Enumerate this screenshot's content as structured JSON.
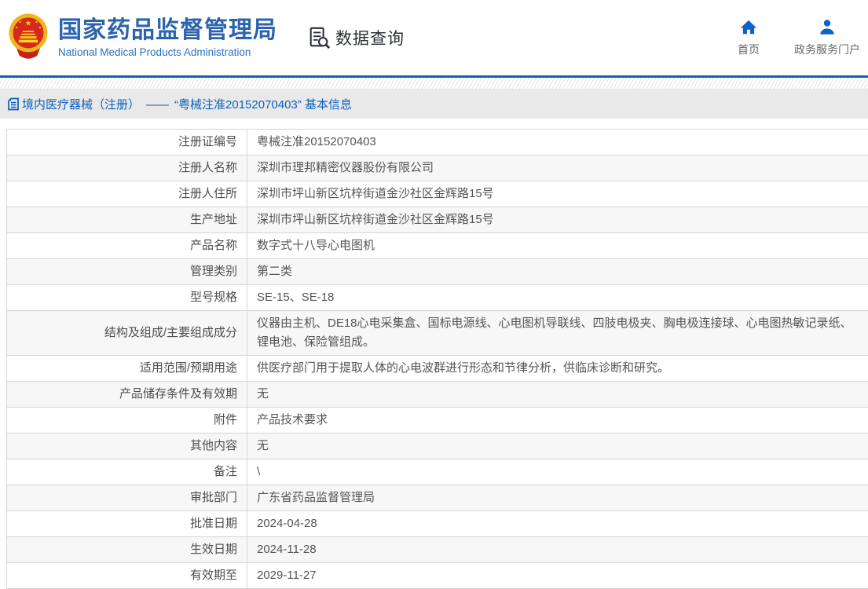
{
  "header": {
    "org_title": "国家药品监督管理局",
    "org_subtitle": "National Medical Products Administration",
    "data_query_label": "数据查询",
    "nav": [
      {
        "icon": "home-icon",
        "label": "首页"
      },
      {
        "icon": "user-icon",
        "label": "政务服务门户"
      }
    ],
    "icons": {
      "logo": "national-emblem-logo",
      "data_query": "document-search-icon"
    }
  },
  "breadcrumb": {
    "icon": "document-icon",
    "category": "境内医疗器械（注册）",
    "separator": "——",
    "title": "“粤械注准20152070403” 基本信息"
  },
  "colors": {
    "brand_blue": "#2b63ad",
    "subtitle_blue": "#2b6ec6",
    "link_blue": "#0a60c0",
    "nav_icon_blue": "#0f62c8",
    "divider_blue": "#1b5ea8",
    "breadcrumb_bg": "#e9e9e9",
    "row_alt_bg": "#f7f7f7",
    "table_border": "#d6d6d6",
    "text_gray": "#555555"
  },
  "table": {
    "rows": [
      {
        "label": "注册证编号",
        "value": "粤械注准20152070403"
      },
      {
        "label": "注册人名称",
        "value": "深圳市理邦精密仪器股份有限公司"
      },
      {
        "label": "注册人住所",
        "value": "深圳市坪山新区坑梓街道金沙社区金辉路15号"
      },
      {
        "label": "生产地址",
        "value": "深圳市坪山新区坑梓街道金沙社区金辉路15号"
      },
      {
        "label": "产品名称",
        "value": "数字式十八导心电图机"
      },
      {
        "label": "管理类别",
        "value": "第二类"
      },
      {
        "label": "型号规格",
        "value": "SE-15、SE-18"
      },
      {
        "label": "结构及组成/主要组成成分",
        "value": "仪器由主机、DE18心电采集盒、国标电源线、心电图机导联线、四肢电极夹、胸电极连接球、心电图热敏记录纸、锂电池、保险管组成。"
      },
      {
        "label": "适用范围/预期用途",
        "value": "供医疗部门用于提取人体的心电波群进行形态和节律分析，供临床诊断和研究。"
      },
      {
        "label": "产品储存条件及有效期",
        "value": "无"
      },
      {
        "label": "附件",
        "value": "产品技术要求"
      },
      {
        "label": "其他内容",
        "value": "无"
      },
      {
        "label": "备注",
        "value": "\\"
      },
      {
        "label": "审批部门",
        "value": "广东省药品监督管理局"
      },
      {
        "label": "批准日期",
        "value": "2024-04-28"
      },
      {
        "label": "生效日期",
        "value": "2024-11-28"
      },
      {
        "label": "有效期至",
        "value": "2029-11-27"
      }
    ]
  }
}
